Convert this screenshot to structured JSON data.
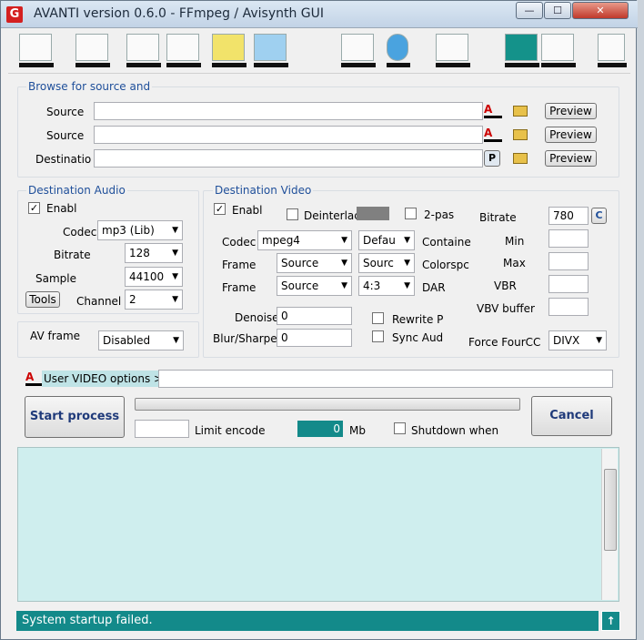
{
  "window": {
    "title": "AVANTI  version  0.6.0  -  FFmpeg / Avisynth GUI",
    "app_icon": "G",
    "minimize": "—",
    "maximize": "☐",
    "close": "✕"
  },
  "toolbar_icons": [
    "open-file-icon",
    "search-icon",
    "edit-script-icon",
    "clipboard-icon",
    "filmstrip-123-icon",
    "waveform-icon",
    "folder-icon",
    "undo-icon",
    "help-icon",
    "upload-icon",
    "grid-window-icon",
    "font-icon"
  ],
  "browse": {
    "group_label": "Browse for source and",
    "rows": [
      {
        "label": "Source",
        "value": "",
        "icon": "A",
        "preview": "Preview"
      },
      {
        "label": "Source",
        "value": "",
        "icon": "A",
        "preview": "Preview"
      },
      {
        "label": "Destinatio",
        "value": "",
        "icon": "P",
        "preview": "Preview"
      }
    ]
  },
  "audio": {
    "group_label": "Destination Audio",
    "enable_label": "Enabl",
    "enable_checked": "✓",
    "codec_label": "Codec",
    "codec_value": "mp3 (Lib)",
    "bitrate_label": "Bitrate",
    "bitrate_value": "128",
    "sample_label": "Sample",
    "sample_value": "44100",
    "tools_label": "Tools",
    "channel_label": "Channel",
    "channel_value": "2"
  },
  "avframe": {
    "label": "AV frame",
    "value": "Disabled"
  },
  "video": {
    "group_label": "Destination Video",
    "enable_label": "Enabl",
    "enable_checked": "✓",
    "deinterlace_label": "Deinterlac",
    "twopass_label": "2-pas",
    "bitrate_label": "Bitrate",
    "bitrate_value": "780",
    "bitrate_c": "C",
    "codec_label": "Codec",
    "codec_value": "mpeg4",
    "default_value": "Defau",
    "container_label": "Containe",
    "min_label": "Min",
    "frame1_label": "Frame",
    "frame1_value": "Source",
    "frame1b_value": "Sourc",
    "colorspace_label": "Colorspc",
    "max_label": "Max",
    "frame2_label": "Frame",
    "frame2_value": "Source",
    "aspect_value": "4:3",
    "dar_label": "DAR",
    "vbr_label": "VBR",
    "denoise_label": "Denoise",
    "denoise_value": "0",
    "rewrite_label": "Rewrite P",
    "vbv_label": "VBV buffer",
    "blur_label": "Blur/Sharpe",
    "blur_value": "0",
    "sync_label": "Sync Aud",
    "fourcc_label": "Force FourCC",
    "fourcc_value": "DIVX"
  },
  "user_options": {
    "label": "User VIDEO options >",
    "value": ""
  },
  "process": {
    "start_label": "Start process",
    "cancel_label": "Cancel",
    "progress": 0,
    "limit_value": "",
    "limit_label": "Limit encode",
    "mb_value": "0",
    "mb_label": "Mb",
    "shutdown_label": "Shutdown when"
  },
  "status": {
    "text": "System startup failed.",
    "up_icon": "↑"
  },
  "colors": {
    "teal": "#138a8a",
    "log_bg": "#cfeeee",
    "title_blue": "#1f4f9a"
  }
}
